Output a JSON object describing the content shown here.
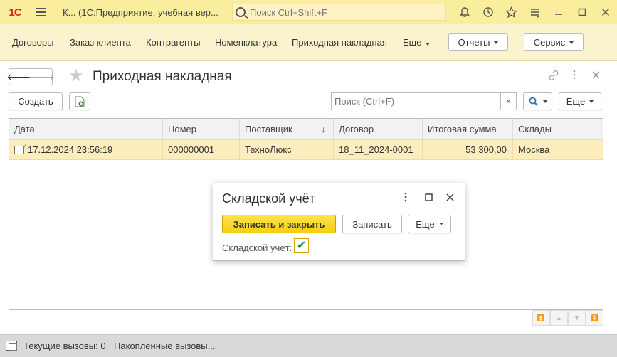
{
  "titlebar": {
    "logo": "1С",
    "window_short": "К...",
    "app_title": "(1С:Предприятие, учебная вер...",
    "search_placeholder": "Поиск Ctrl+Shift+F",
    "icons": [
      "bell-icon",
      "history-icon",
      "star-icon",
      "menu-icon",
      "minimize-icon",
      "maximize-icon",
      "close-icon"
    ]
  },
  "nav": {
    "items": [
      "Договоры",
      "Заказ клиента",
      "Контрагенты",
      "Номенклатура",
      "Приходная накладная"
    ],
    "more": "Еще",
    "reports": "Отчеты",
    "service": "Сервис"
  },
  "form": {
    "title": "Приходная накладная",
    "create_button": "Создать",
    "search_placeholder": "Поиск (Ctrl+F)",
    "clear": "×",
    "more_button": "Еще"
  },
  "table": {
    "columns": [
      "Дата",
      "Номер",
      "Поставщик",
      "Договор",
      "Итоговая сумма",
      "Склады"
    ],
    "sort_indicator": "↓",
    "rows": [
      {
        "date": "17.12.2024 23:56:19",
        "number": "000000001",
        "supplier": "ТехноЛюкс",
        "contract": "18_11_2024-0001",
        "total": "53 300,00",
        "warehouse": "Москва"
      }
    ]
  },
  "modal": {
    "title": "Складской учёт",
    "save_close": "Записать и закрыть",
    "save": "Записать",
    "more": "Еще",
    "checkbox_label": "Складской учёт:",
    "checkbox_checked": true
  },
  "status": {
    "current_calls": "Текущие вызовы: 0",
    "accumulated_calls": "Накопленные вызовы..."
  },
  "colors": {
    "titlebar": "#fbed9e",
    "nav": "#fbf3cd",
    "selected_row": "#fbedbd",
    "primary_button": "#f7cf12",
    "check": "#1d8a4a"
  }
}
